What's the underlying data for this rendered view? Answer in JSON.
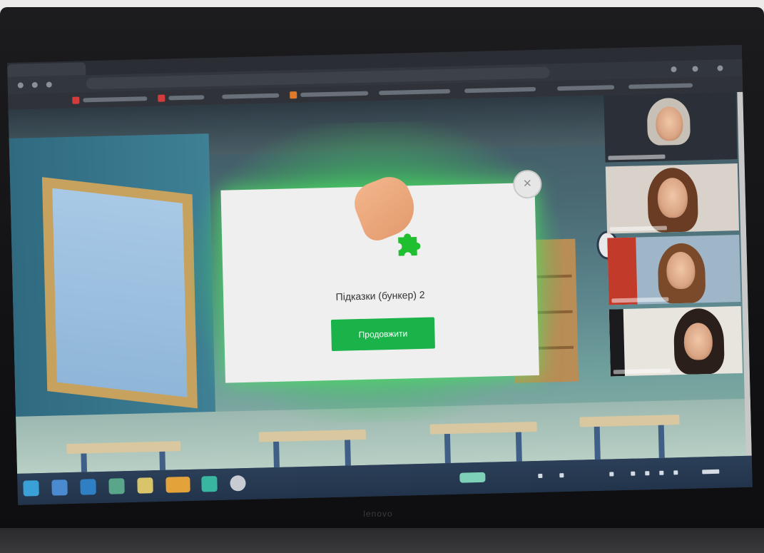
{
  "laptop": {
    "brand_text": "lenovo"
  },
  "browser": {
    "tab_title": "",
    "address": "",
    "bookmarks": [
      "",
      "",
      "",
      "",
      "",
      "",
      "",
      "",
      ""
    ]
  },
  "modal": {
    "message": "Підказки (бункер) 2",
    "button_label": "Продовжити",
    "close_symbol": "×"
  },
  "video_call": {
    "participants": [
      "participant-1",
      "participant-2",
      "participant-3",
      "participant-4"
    ]
  },
  "colors": {
    "accent_green": "#19b34a",
    "glow_green": "#46dc5a",
    "taskbar": "#2b3f58"
  }
}
